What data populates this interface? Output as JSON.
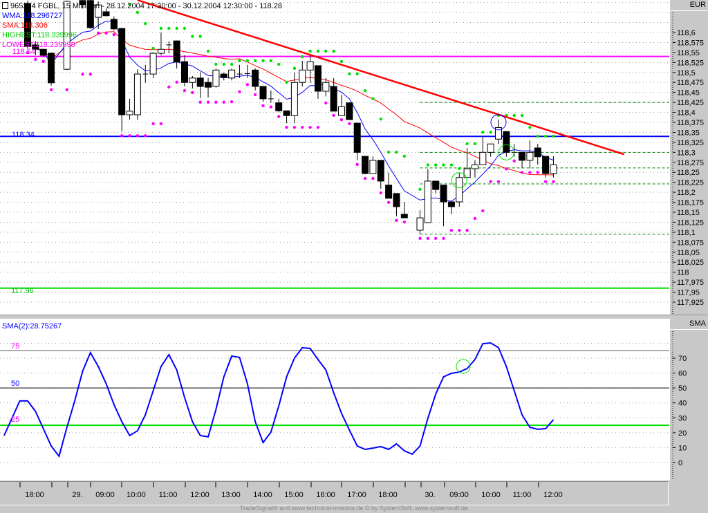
{
  "header": {
    "title": "965264 FGBL, 15 Minuten - 28.12.2004 17:30:00 - 30.12.2004 12:30:00 - 118.28",
    "currency": "EUR"
  },
  "legend": {
    "wma": "WMA:118.296727",
    "sma": "SMA:118.306",
    "highest": "HIGHEST:118.339996",
    "lowest": "LOWEST:118.239998"
  },
  "levels": [
    {
      "label": "118.54",
      "value": 118.54,
      "color": "#ff00ff"
    },
    {
      "label": "118.34",
      "value": 118.34,
      "color": "#0000ff"
    },
    {
      "label": "117.96",
      "value": 117.96,
      "color": "#00e000"
    }
  ],
  "osc_panel": {
    "legend": "SMA(2):28.75267",
    "axis_title": "SMA",
    "levels": [
      {
        "label": "75",
        "value": 75,
        "color": "#ff00ff"
      },
      {
        "label": "50",
        "value": 50,
        "color": "#000000"
      },
      {
        "label": "25",
        "value": 25,
        "color": "#00e000"
      }
    ]
  },
  "price_ticks": [
    "118,6",
    "118,575",
    "118,55",
    "118,525",
    "118,5",
    "118,475",
    "118,45",
    "118,425",
    "118,4",
    "118,375",
    "118,35",
    "118,325",
    "118,3",
    "118,275",
    "118,25",
    "118,225",
    "118,2",
    "118,175",
    "118,15",
    "118,125",
    "118,1",
    "118,075",
    "118,05",
    "118,025",
    "118",
    "117,975",
    "117,95",
    "117,925"
  ],
  "osc_ticks": [
    "70",
    "60",
    "50",
    "40",
    "30",
    "20",
    "10",
    "0"
  ],
  "time_labels": [
    "18:00",
    "29.",
    "09:00",
    "10:00",
    "11:00",
    "12:00",
    "13:00",
    "14:00",
    "15:00",
    "16:00",
    "17:00",
    "18:00",
    "30.",
    "09:00",
    "10:00",
    "11:00",
    "12:00"
  ],
  "footer": "TradeSignal® and www.technical-investor.de © by SystemSoft, www.systemsoft.de",
  "colors": {
    "wma": "#0000ff",
    "sma": "#ff0000",
    "trend": "#ff0000",
    "highest": "#00e000",
    "lowest": "#ff00ff",
    "osc": "#0000ff"
  },
  "chart_data": {
    "type": "candlestick",
    "interval": "15 Minuten",
    "ylim": [
      117.925,
      118.6
    ],
    "candles_ohlc": [
      [
        118.673,
        118.68,
        118.56,
        118.565
      ],
      [
        118.569,
        118.578,
        118.543,
        118.558
      ],
      [
        118.558,
        118.558,
        118.538,
        118.543
      ],
      [
        118.548,
        118.55,
        118.467,
        118.474
      ],
      null,
      [
        118.508,
        118.68,
        118.506,
        118.678
      ],
      null,
      [
        118.68,
        118.682,
        118.66,
        118.67
      ],
      [
        118.68,
        118.682,
        118.609,
        118.612
      ],
      [
        118.638,
        118.678,
        118.609,
        118.669
      ],
      [
        118.652,
        118.66,
        118.64,
        118.642
      ],
      [
        118.633,
        118.64,
        118.605,
        118.609
      ],
      [
        118.61,
        118.612,
        118.352,
        118.394
      ],
      [
        118.394,
        118.434,
        118.382,
        118.403
      ],
      [
        118.394,
        118.508,
        118.382,
        118.496
      ],
      [
        118.496,
        118.519,
        118.474,
        118.496
      ],
      [
        118.496,
        118.55,
        118.486,
        118.548
      ],
      [
        118.548,
        118.6,
        118.543,
        118.558
      ],
      [
        118.569,
        118.578,
        118.548,
        118.569
      ],
      [
        118.579,
        118.58,
        118.51,
        118.526
      ],
      [
        118.527,
        118.543,
        118.465,
        118.475
      ],
      [
        118.475,
        118.491,
        118.46,
        118.486
      ],
      [
        118.486,
        118.5,
        118.436,
        118.465
      ],
      [
        118.475,
        118.486,
        118.437,
        118.463
      ],
      [
        118.465,
        118.51,
        118.462,
        118.506
      ],
      [
        118.496,
        118.5,
        118.48,
        118.487
      ],
      [
        118.486,
        118.51,
        118.48,
        118.506
      ],
      [
        118.496,
        118.519,
        118.486,
        118.496
      ],
      [
        118.496,
        118.519,
        118.486,
        118.497
      ],
      [
        118.506,
        118.51,
        118.455,
        118.465
      ],
      [
        118.465,
        118.465,
        118.427,
        118.434
      ],
      [
        118.434,
        118.455,
        118.424,
        118.434
      ],
      [
        118.424,
        118.434,
        118.4,
        118.404
      ],
      [
        118.404,
        118.404,
        118.373,
        118.392
      ],
      [
        118.392,
        118.5,
        118.373,
        118.475
      ],
      [
        118.475,
        118.529,
        118.465,
        118.506
      ],
      [
        118.506,
        118.543,
        118.474,
        118.527
      ],
      [
        118.517,
        118.517,
        118.434,
        118.453
      ],
      [
        118.453,
        118.486,
        118.44,
        118.475
      ],
      [
        118.465,
        118.486,
        118.403,
        118.403
      ],
      [
        118.392,
        118.444,
        118.392,
        118.414
      ],
      [
        118.424,
        118.424,
        118.382,
        118.382
      ],
      [
        118.373,
        118.373,
        118.28,
        118.3
      ],
      [
        118.29,
        118.29,
        118.245,
        118.247
      ],
      [
        118.247,
        118.29,
        118.247,
        118.28
      ],
      [
        118.28,
        118.28,
        118.209,
        118.228
      ],
      [
        118.218,
        118.249,
        118.185,
        118.185
      ],
      [
        118.197,
        118.197,
        118.14,
        118.164
      ],
      [
        118.145,
        118.176,
        118.136,
        118.136
      ],
      null,
      [
        118.105,
        118.155,
        118.095,
        118.136
      ],
      [
        118.124,
        118.258,
        118.124,
        118.228
      ],
      [
        118.228,
        118.228,
        118.197,
        118.207
      ],
      [
        118.218,
        118.218,
        118.115,
        118.176
      ],
      [
        118.176,
        118.176,
        118.145,
        118.164
      ],
      [
        118.176,
        118.249,
        118.164,
        118.237
      ],
      [
        118.237,
        118.311,
        118.237,
        118.259
      ],
      [
        118.259,
        118.28,
        118.237,
        118.269
      ],
      [
        118.269,
        118.34,
        118.269,
        118.3
      ],
      [
        118.3,
        118.321,
        118.289,
        118.321
      ],
      [
        118.333,
        118.382,
        118.321,
        118.362
      ],
      [
        118.352,
        118.352,
        118.289,
        118.3
      ],
      [
        118.3,
        118.321,
        118.289,
        118.3
      ],
      [
        118.3,
        118.3,
        118.26,
        118.28
      ],
      [
        118.28,
        118.33,
        118.26,
        118.3
      ],
      [
        118.311,
        118.321,
        118.269,
        118.289
      ],
      [
        118.29,
        118.29,
        118.237,
        118.247
      ],
      [
        118.247,
        118.29,
        118.237,
        118.269
      ]
    ],
    "trendline": {
      "start": {
        "bar": 14,
        "price": 118.681
      },
      "end": {
        "bar": 76,
        "price": 118.295
      }
    },
    "support_resistance_dashed": [
      118.425,
      118.3,
      118.261,
      118.221,
      118.095
    ],
    "dashed_from_bar": 50,
    "oscillator": {
      "name": "SMA(2)",
      "ylim": [
        -5,
        85
      ],
      "start_bar": -3,
      "values": [
        18.1,
        29.7,
        41.3,
        41.3,
        34.3,
        22.7,
        11.1,
        4.2,
        23.6,
        41.3,
        61.2,
        73.7,
        64.4,
        52.9,
        38.9,
        27.4,
        18.1,
        21.3,
        32,
        48.2,
        64.4,
        72.3,
        62.1,
        43.6,
        27.4,
        18.1,
        17.2,
        35.7,
        57.5,
        71.4,
        70.5,
        52.9,
        27.4,
        13.4,
        20.4,
        38,
        57.5,
        70,
        77,
        76.5,
        69.1,
        62.1,
        46.8,
        32.9,
        21.8,
        11.1,
        8.8,
        9.7,
        10.7,
        8.8,
        12.5,
        7.9,
        5.6,
        11.1,
        29.7,
        45.9,
        57.5,
        59.8,
        60.7,
        63,
        69.1,
        79.7,
        80.2,
        77,
        64.4,
        48.2,
        32,
        23.6,
        22.3,
        22.7,
        28.75
      ]
    }
  }
}
